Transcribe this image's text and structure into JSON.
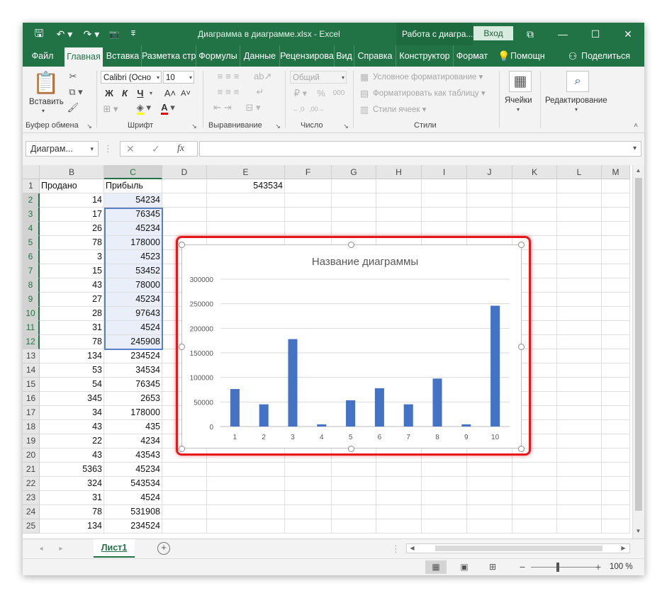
{
  "title_bar": {
    "file_title": "Диаграмма в диаграмме.xlsx  -  Excel",
    "context_tab": "Работа с диагра...",
    "login": "Вход",
    "qa_save": "🖫",
    "qa_undo": "↶ ▾",
    "qa_redo": "↷ ▾",
    "qa_camera": "📷",
    "qa_customize": "⩱",
    "restore": "⧉",
    "minimize": "—",
    "maximize": "☐",
    "close": "✕"
  },
  "tabs": [
    "Файл",
    "Главная",
    "Вставка",
    "Разметка стр",
    "Формулы",
    "Данные",
    "Рецензирова",
    "Вид",
    "Справка",
    "Конструктор",
    "Формат"
  ],
  "tabs_extra": {
    "help_search": "Помощн",
    "share": "Поделиться"
  },
  "ribbon": {
    "clipboard": {
      "paste": "Вставить",
      "label": "Буфер обмена"
    },
    "font": {
      "name": "Calibri (Осно",
      "size": "10",
      "bold": "Ж",
      "italic": "К",
      "underline": "Ч",
      "grow": "A˄",
      "shrink": "A˅",
      "label": "Шрифт"
    },
    "alignment": {
      "label": "Выравнивание"
    },
    "number": {
      "format": "Общий",
      "percent": "%",
      "thousands": "000",
      "label": "Число"
    },
    "styles": {
      "conditional": "Условное форматирование",
      "as_table": "Форматировать как таблицу",
      "cell_styles": "Стили ячеек",
      "label": "Стили"
    },
    "cells": {
      "label": "Ячейки"
    },
    "editing": {
      "label": "Редактирование"
    }
  },
  "formula_bar": {
    "name_box": "Диаграм...",
    "cancel": "✕",
    "enter": "✓",
    "fx": "fx",
    "value": ""
  },
  "columns": [
    "B",
    "C",
    "D",
    "E",
    "F",
    "G",
    "H",
    "I",
    "J",
    "K",
    "L",
    "M"
  ],
  "rows": [
    {
      "n": "1",
      "b": "Продано",
      "c": "Прибыль",
      "e": "543534"
    },
    {
      "n": "2",
      "b": "14",
      "c": "54234"
    },
    {
      "n": "3",
      "b": "17",
      "c": "76345"
    },
    {
      "n": "4",
      "b": "26",
      "c": "45234"
    },
    {
      "n": "5",
      "b": "78",
      "c": "178000"
    },
    {
      "n": "6",
      "b": "3",
      "c": "4523"
    },
    {
      "n": "7",
      "b": "15",
      "c": "53452"
    },
    {
      "n": "8",
      "b": "43",
      "c": "78000"
    },
    {
      "n": "9",
      "b": "27",
      "c": "45234"
    },
    {
      "n": "10",
      "b": "28",
      "c": "97643"
    },
    {
      "n": "11",
      "b": "31",
      "c": "4524"
    },
    {
      "n": "12",
      "b": "78",
      "c": "245908"
    },
    {
      "n": "13",
      "b": "134",
      "c": "234524"
    },
    {
      "n": "14",
      "b": "53",
      "c": "34534"
    },
    {
      "n": "15",
      "b": "54",
      "c": "76345"
    },
    {
      "n": "16",
      "b": "345",
      "c": "2653"
    },
    {
      "n": "17",
      "b": "34",
      "c": "178000"
    },
    {
      "n": "18",
      "b": "43",
      "c": "435"
    },
    {
      "n": "19",
      "b": "22",
      "c": "4234"
    },
    {
      "n": "20",
      "b": "43",
      "c": "43543"
    },
    {
      "n": "21",
      "b": "5363",
      "c": "45234"
    },
    {
      "n": "22",
      "b": "324",
      "c": "543534"
    },
    {
      "n": "23",
      "b": "31",
      "c": "4524"
    },
    {
      "n": "24",
      "b": "78",
      "c": "531908"
    },
    {
      "n": "25",
      "b": "134",
      "c": "234524"
    }
  ],
  "chart_data": {
    "type": "bar",
    "title": "Название диаграммы",
    "categories": [
      "1",
      "2",
      "3",
      "4",
      "5",
      "6",
      "7",
      "8",
      "9",
      "10"
    ],
    "values": [
      76345,
      45234,
      178000,
      4523,
      53452,
      78000,
      45234,
      97643,
      4524,
      245908
    ],
    "ylim": [
      0,
      300000
    ],
    "yticks": [
      "0",
      "50000",
      "100000",
      "150000",
      "200000",
      "250000",
      "300000"
    ],
    "xlabel": "",
    "ylabel": "",
    "grid": true,
    "bar_color": "#4472c4"
  },
  "sheet_bar": {
    "sheet_name": "Лист1",
    "add": "+"
  },
  "status_bar": {
    "zoom": "100 %",
    "zoom_out": "−",
    "zoom_in": "+"
  }
}
